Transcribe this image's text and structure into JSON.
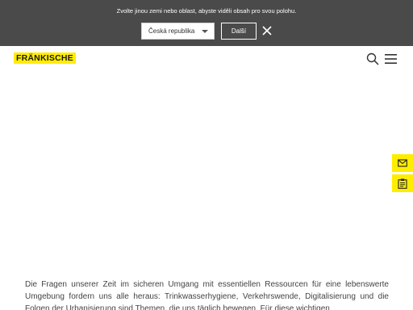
{
  "region_banner": {
    "message": "Zvolte jinou zemi nebo oblast, abyste viděli obsah pro svou polohu.",
    "selected_country": "Česká republika",
    "next_label": "Další"
  },
  "header": {
    "logo_text": "FRÄNKISCHE"
  },
  "icons": {
    "close": "close-icon",
    "search": "search-icon",
    "menu": "hamburger-menu-icon",
    "mail": "mail-icon",
    "clipboard": "clipboard-icon"
  },
  "colors": {
    "brand_yellow": "#ffed00",
    "banner_bg": "#4a4a4a"
  },
  "intro_text": "Die Fragen unserer Zeit im sicheren Umgang mit essentiellen Ressourcen für eine lebenswerte Umgebung fordern uns alle heraus: Trinkwasserhygiene, Verkehrswende, Digitalisierung und die Folgen der Urbanisierung sind Themen, die uns täglich bewegen. Für diese wichtigen"
}
